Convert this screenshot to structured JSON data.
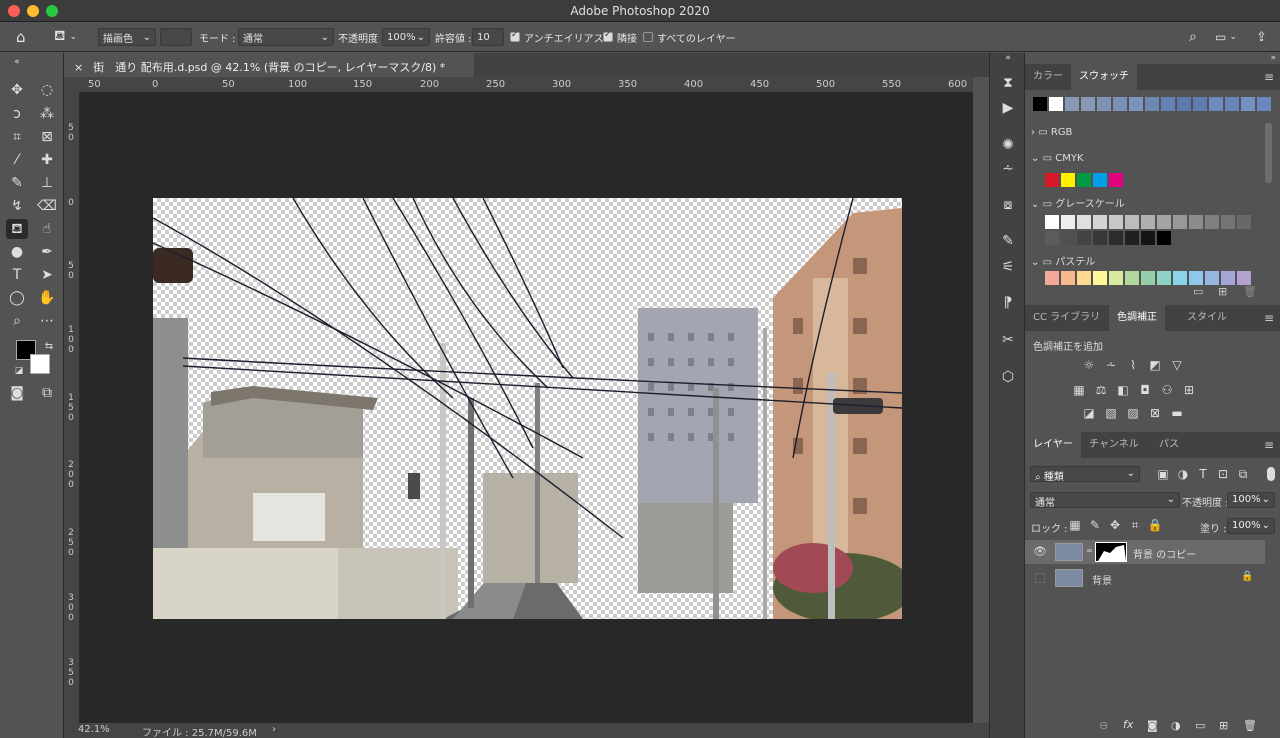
{
  "app": {
    "title": "Adobe Photoshop 2020"
  },
  "optionsbar": {
    "fill_source": "描画色",
    "mode_label": "モード :",
    "mode_value": "通常",
    "opacity_label": "不透明度 :",
    "opacity_value": "100%",
    "tolerance_label": "許容値 :",
    "tolerance_value": "10",
    "antialias_label": "アンチエイリアス",
    "contiguous_label": "隣接",
    "all_layers_label": "すべてのレイヤー"
  },
  "document": {
    "tab_title": "街　通り 配布用.d.psd @ 42.1% (背景 のコピー, レイヤーマスク/8) *",
    "ruler_h": [
      "50",
      "0",
      "50",
      "100",
      "150",
      "200",
      "250",
      "300",
      "350",
      "400",
      "450",
      "500",
      "550",
      "600"
    ],
    "ruler_v": [
      "50",
      "0",
      "50",
      "100",
      "150",
      "200",
      "250",
      "300",
      "350"
    ],
    "zoom": "42.1%",
    "file_info": "ファイル : 25.7M/59.6M"
  },
  "swatches_panel": {
    "tabs": [
      "カラー",
      "スウォッチ"
    ],
    "active_tab": "スウォッチ",
    "recent": [
      "#000000",
      "#ffffff",
      "#8a9ab6",
      "#8a9ab6",
      "#7f93b5",
      "#7b91b7",
      "#7d95bc",
      "#6e88b4",
      "#6581b3",
      "#5b7ab0",
      "#5e7db5",
      "#6c8abc",
      "#6986ba",
      "#7591c0",
      "#6a88bd"
    ],
    "groups": [
      {
        "name": "RGB",
        "open": false,
        "colors": []
      },
      {
        "name": "CMYK",
        "open": true,
        "colors": [
          "#d7182a",
          "#fff100",
          "#009944",
          "#00a0e9",
          "#e4007f"
        ]
      },
      {
        "name": "グレースケール",
        "open": true,
        "colors": [
          "#ffffff",
          "#eeeeee",
          "#e0e0e0",
          "#d4d4d4",
          "#c8c8c8",
          "#bcbcbc",
          "#b0b0b0",
          "#a4a4a4",
          "#989898",
          "#8c8c8c",
          "#808080",
          "#747474",
          "#686868",
          "#5c5c5c",
          "#505050",
          "#444444",
          "#383838",
          "#2c2c2c",
          "#202020",
          "#141414",
          "#000000"
        ]
      },
      {
        "name": "パステル",
        "open": true,
        "colors": [
          "#f4a89a",
          "#f7b88f",
          "#fcd98e",
          "#fff799",
          "#d9e9a0",
          "#b1d79d",
          "#95cfa9",
          "#8dd3c6",
          "#89d4e7",
          "#8ec6ec",
          "#96b5e0",
          "#a3a6d7",
          "#b5a1d0"
        ]
      }
    ]
  },
  "adjustments_panel": {
    "tabs": [
      "CC ライブラリ",
      "色調補正",
      "スタイル"
    ],
    "active_tab": "色調補正",
    "heading": "色調補正を追加"
  },
  "layers_panel": {
    "tabs": [
      "レイヤー",
      "チャンネル",
      "パス"
    ],
    "active_tab": "レイヤー",
    "filter_value": "種類",
    "blend_mode": "通常",
    "opacity_label": "不透明度 :",
    "opacity_value": "100%",
    "lock_label": "ロック :",
    "fill_label": "塗り :",
    "fill_value": "100%",
    "layers": [
      {
        "name": "背景 のコピー",
        "visible": true,
        "selected": true,
        "has_mask": true,
        "locked": false
      },
      {
        "name": "背景",
        "visible": false,
        "selected": false,
        "has_mask": false,
        "locked": true
      }
    ]
  }
}
